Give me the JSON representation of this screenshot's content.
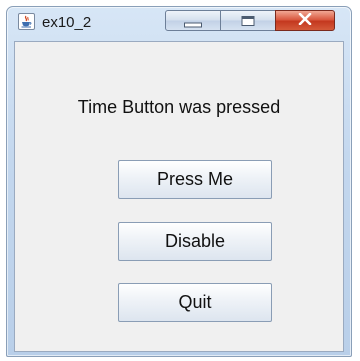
{
  "window": {
    "title": "ex10_2",
    "icon": "java-cup-icon",
    "controls": {
      "minimize_icon": "minimize-icon",
      "maximize_icon": "maximize-icon",
      "close_icon": "close-icon"
    }
  },
  "content": {
    "message": "Time Button was pressed",
    "buttons": [
      {
        "label": "Press Me"
      },
      {
        "label": "Disable"
      },
      {
        "label": "Quit"
      }
    ]
  },
  "colors": {
    "close_button": "#c4381f",
    "frame": "#c3d7ee",
    "panel": "#f0f0f0"
  }
}
